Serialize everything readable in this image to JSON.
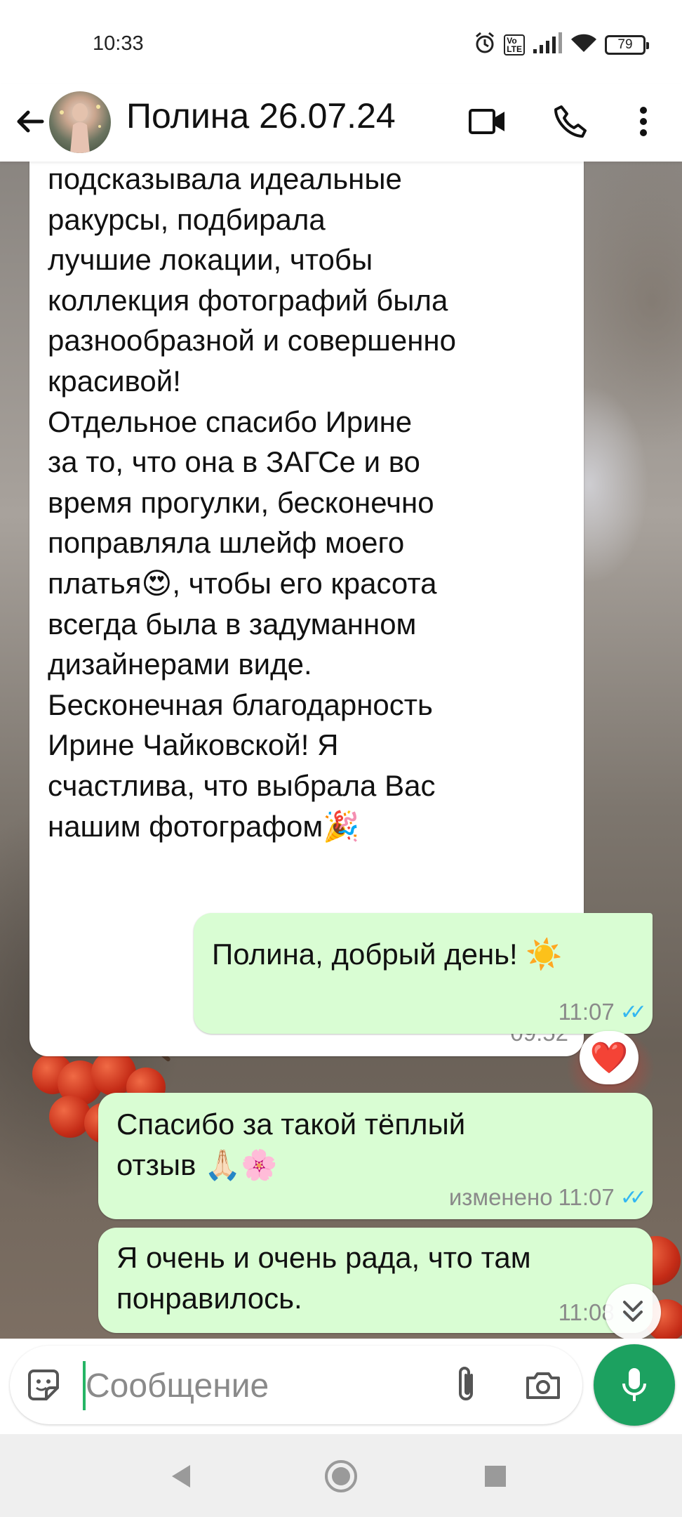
{
  "status_bar": {
    "time": "10:33",
    "battery": "79"
  },
  "header": {
    "contact_name": "Полина 26.07.24"
  },
  "messages": [
    {
      "direction": "incoming",
      "text": "подсказывала идеальные\nракурсы, подбирала\nлучшие локации, чтобы\nколлекция фотографий была\nразнообразной и совершенно\nкрасивой!\nОтдельное спасибо Ирине\nза то, что она в ЗАГСе и во\nвремя прогулки, бесконечно\nпоправляла шлейф моего\nплатья😍, чтобы его красота\nвсегда была в задуманном\nдизайнерами виде.\nБесконечная благодарность\nИрине Чайковской! Я\nсчастлива, что выбрала Вас\nнашим  фотографом🎉",
      "time": "09:52"
    },
    {
      "direction": "outgoing",
      "text": "Полина, добрый день! ☀️",
      "time": "11:07",
      "status": "read",
      "reaction": "❤️"
    },
    {
      "direction": "outgoing",
      "text": "Спасибо за такой тёплый\nотзыв 🙏🏻🌸",
      "edited_label": "изменено",
      "time": "11:07",
      "status": "read"
    },
    {
      "direction": "outgoing",
      "text": "Я очень и очень рада, что там\nпонравилось.",
      "time": "11:08",
      "status": "read"
    }
  ],
  "composer": {
    "placeholder": "Сообщение"
  },
  "colors": {
    "outgoing_bubble": "#d9fdd3",
    "incoming_bubble": "#ffffff",
    "accent_green": "#1ca160",
    "read_ticks": "#34b7f1"
  },
  "icons": [
    "back-arrow-icon",
    "video-call-icon",
    "phone-icon",
    "more-options-icon",
    "sticker-icon",
    "attach-icon",
    "camera-icon",
    "mic-icon",
    "chevron-down-icon",
    "heart-icon",
    "nav-back-icon",
    "nav-home-icon",
    "nav-recents-icon"
  ]
}
